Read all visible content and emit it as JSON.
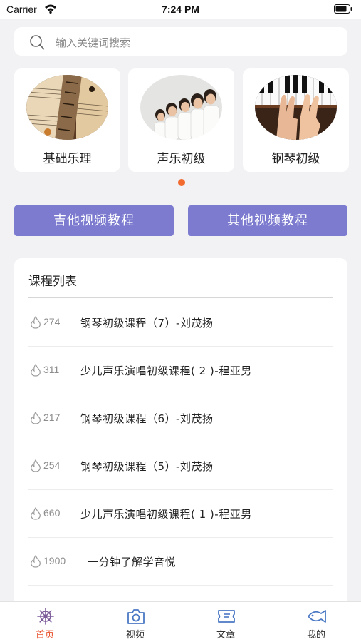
{
  "status_bar": {
    "carrier": "Carrier",
    "time": "7:24 PM"
  },
  "search": {
    "placeholder": "输入关键词搜索",
    "icon": "search-icon"
  },
  "categories": [
    {
      "label": "基础乐理",
      "image": "guitar-sheet-music-photo"
    },
    {
      "label": "声乐初级",
      "image": "children-choir-photo"
    },
    {
      "label": "钢琴初级",
      "image": "hands-on-piano-photo"
    }
  ],
  "carousel": {
    "active_dot_color": "#f26a2e"
  },
  "video_buttons": [
    {
      "label": "吉他视频教程"
    },
    {
      "label": "其他视频教程"
    }
  ],
  "course_list": {
    "title": "课程列表",
    "items": [
      {
        "views": "274",
        "title": "钢琴初级课程（7）-刘茂扬"
      },
      {
        "views": "311",
        "title": "少儿声乐演唱初级课程( 2 )-程亚男"
      },
      {
        "views": "217",
        "title": "钢琴初级课程（6）-刘茂扬"
      },
      {
        "views": "254",
        "title": "钢琴初级课程（5）-刘茂扬"
      },
      {
        "views": "660",
        "title": "少儿声乐演唱初级课程( 1 )-程亚男"
      },
      {
        "views": "1900",
        "title": "一分钟了解学音悦"
      }
    ]
  },
  "tab_bar": {
    "items": [
      {
        "label": "首页",
        "icon": "ship-wheel-icon",
        "active": true
      },
      {
        "label": "视频",
        "icon": "camera-icon",
        "active": false
      },
      {
        "label": "文章",
        "icon": "ticket-icon",
        "active": false
      },
      {
        "label": "我的",
        "icon": "fish-icon",
        "active": false
      }
    ]
  },
  "colors": {
    "accent": "#e8522b",
    "button": "#7c7bd0",
    "tab_icon": "#4a78c4",
    "background": "#f2f2f4"
  }
}
